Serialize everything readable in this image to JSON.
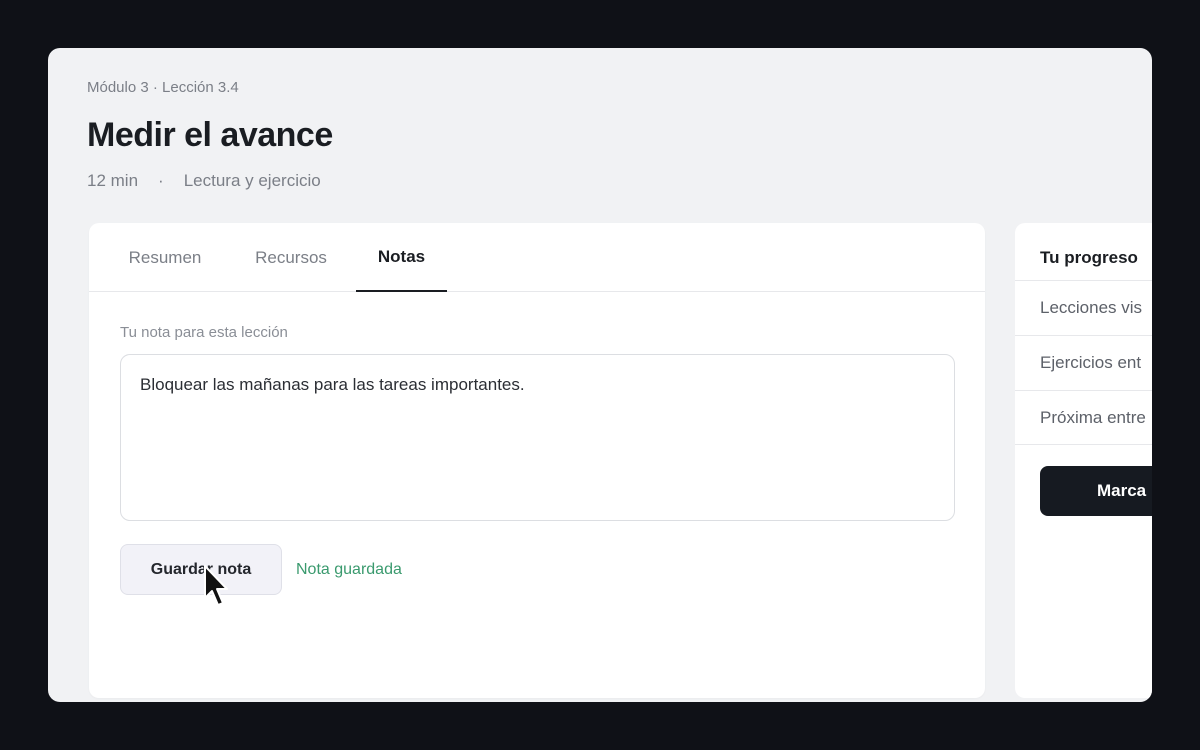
{
  "header": {
    "breadcrumb": "Módulo 3 · Lección 3.4",
    "title": "Medir el avance",
    "duration": "12 min",
    "separator": "·",
    "type": "Lectura y ejercicio"
  },
  "tabs": [
    {
      "label": "Resumen",
      "active": false
    },
    {
      "label": "Recursos",
      "active": false
    },
    {
      "label": "Notas",
      "active": true
    }
  ],
  "notes": {
    "label": "Tu nota para esta lección",
    "value": "Bloquear las mañanas para las tareas importantes.",
    "save_label": "Guardar nota",
    "status": "Nota guardada"
  },
  "progress": {
    "title": "Tu progreso",
    "rows": [
      "Lecciones vis",
      "Ejercicios ent",
      "Próxima entre"
    ],
    "action_label": "Marca"
  },
  "colors": {
    "background": "#0f1117",
    "status_green": "#3a9a6e",
    "primary_button": "#161a21"
  },
  "icons": {
    "cursor": "mouse-pointer-icon"
  }
}
